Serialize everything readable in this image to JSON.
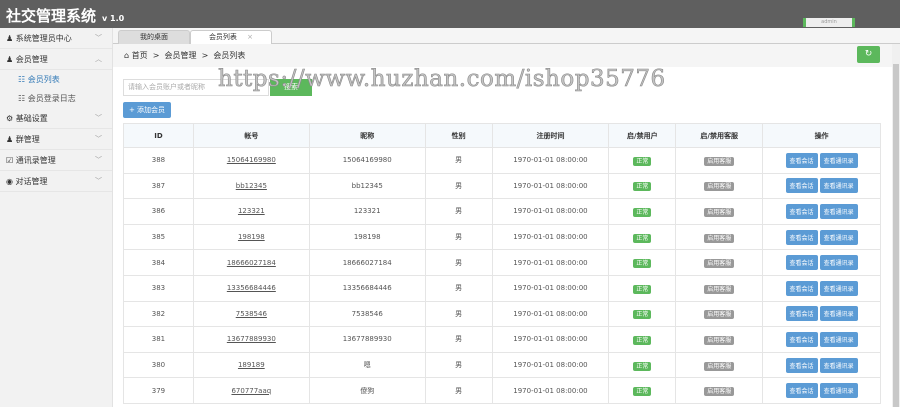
{
  "header": {
    "title": "社交管理系统",
    "version": "v 1.0",
    "user_btn": "admin"
  },
  "sidebar": {
    "items": [
      {
        "label": "系统管理员中心",
        "icon": "user-icon",
        "chev": "﹀"
      },
      {
        "label": "会员管理",
        "icon": "user-icon",
        "chev": "︿",
        "subs": [
          {
            "label": "会员列表"
          },
          {
            "label": "会员登录日志"
          }
        ]
      },
      {
        "label": "基础设置",
        "icon": "gear-icon",
        "chev": "﹀"
      },
      {
        "label": "群管理",
        "icon": "group-icon",
        "chev": "﹀"
      },
      {
        "label": "通讯录管理",
        "icon": "edit-icon",
        "chev": "﹀"
      },
      {
        "label": "对话管理",
        "icon": "eye-icon",
        "chev": "﹀"
      }
    ]
  },
  "tabs": [
    {
      "label": "我的桌面"
    },
    {
      "label": "会员列表",
      "close": "×"
    }
  ],
  "breadcrumb": [
    "首页",
    ">",
    "会员管理",
    ">",
    "会员列表"
  ],
  "search": {
    "placeholder": "请输入会员账户或者昵称",
    "button": "搜索"
  },
  "add_button": "+ 添加会员",
  "table": {
    "headers": [
      "ID",
      "帐号",
      "昵称",
      "性别",
      "注册时间",
      "启/禁用户",
      "启/禁用客服",
      "操作"
    ],
    "status_label": "正常",
    "kf_label": "启用客服",
    "action1": "查看会话",
    "action2": "查看通讯录",
    "rows": [
      [
        "388",
        "15064169980",
        "15064169980",
        "男",
        "1970-01-01 08:00:00"
      ],
      [
        "387",
        "bb12345",
        "bb12345",
        "男",
        "1970-01-01 08:00:00"
      ],
      [
        "386",
        "123321",
        "123321",
        "男",
        "1970-01-01 08:00:00"
      ],
      [
        "385",
        "198198",
        "198198",
        "男",
        "1970-01-01 08:00:00"
      ],
      [
        "384",
        "18666027184",
        "18666027184",
        "男",
        "1970-01-01 08:00:00"
      ],
      [
        "383",
        "13356684446",
        "13356684446",
        "男",
        "1970-01-01 08:00:00"
      ],
      [
        "382",
        "7538546",
        "7538546",
        "男",
        "1970-01-01 08:00:00"
      ],
      [
        "381",
        "13677889930",
        "13677889930",
        "男",
        "1970-01-01 08:00:00"
      ],
      [
        "380",
        "189189",
        "嗯",
        "男",
        "1970-01-01 08:00:00"
      ],
      [
        "379",
        "670777aaq",
        "傻狗",
        "男",
        "1970-01-01 08:00:00"
      ]
    ]
  },
  "watermark": "https://www.huzhan.com/ishop35776"
}
